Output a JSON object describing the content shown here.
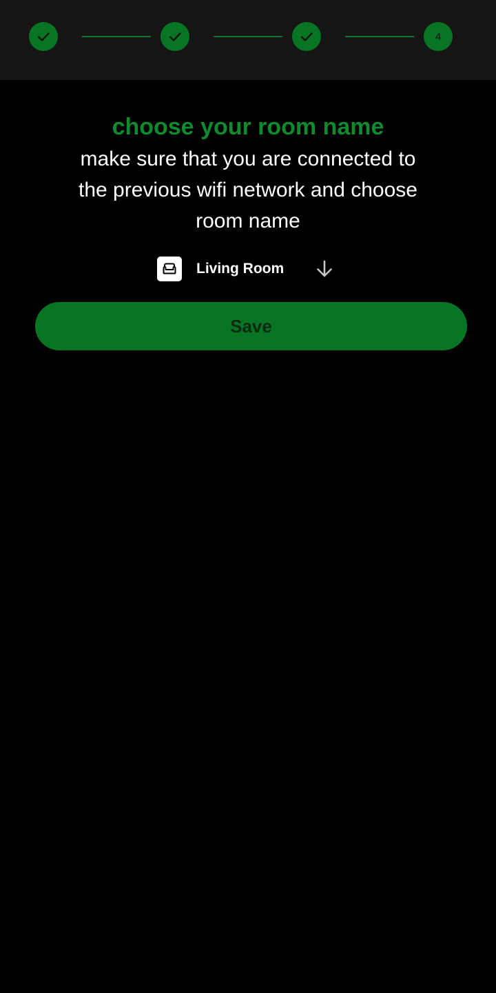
{
  "stepper": {
    "steps": [
      {
        "state": "completed",
        "icon": "check-icon"
      },
      {
        "state": "completed",
        "icon": "check-icon"
      },
      {
        "state": "completed",
        "icon": "check-icon"
      },
      {
        "state": "current",
        "number": "4"
      }
    ]
  },
  "content": {
    "title": "choose your room name",
    "instructions": "make sure that you are connected to the previous wifi network and choose room name"
  },
  "room_select": {
    "icon": "sofa-icon",
    "selected": "Living Room",
    "dropdown_icon": "arrow-down-icon"
  },
  "save_button": {
    "label": "Save"
  },
  "colors": {
    "accent": "#087524",
    "title": "#108a2e",
    "background": "#000000",
    "header_background": "#151515"
  }
}
